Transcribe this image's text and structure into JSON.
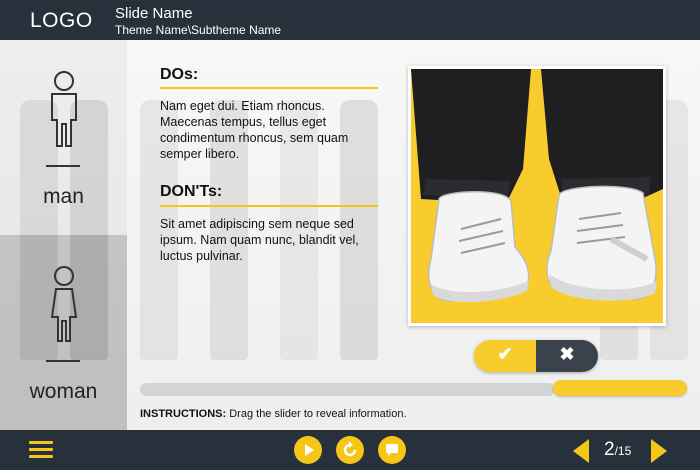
{
  "header": {
    "logo": "LOGO",
    "slide_name": "Slide Name",
    "theme_name": "Theme Name\\Subtheme Name"
  },
  "sidebar": {
    "items": [
      {
        "label": "man",
        "icon": "man-icon",
        "selected": false
      },
      {
        "label": "woman",
        "icon": "woman-icon",
        "selected": true
      }
    ]
  },
  "main": {
    "dos_title": "DOs:",
    "dos_text": "Nam eget dui. Etiam rhoncus. Maecenas tempus, tellus eget condimentum rhoncus, sem quam semper libero.",
    "donts_title": "DON'Ts:",
    "donts_text": "Sit amet adipiscing sem neque sed ipsum. Nam quam nunc, blandit vel, luctus pulvinar.",
    "photo": "sneakers-photo"
  },
  "answer_buttons": {
    "yes_icon": "✔",
    "no_icon": "✖"
  },
  "slider": {
    "value": 1.0
  },
  "instructions": {
    "label": "INSTRUCTIONS:",
    "text": "Drag the slider to reveal information."
  },
  "footer": {
    "page_current": "2",
    "page_total": "/15"
  },
  "colors": {
    "accent": "#f5c518",
    "bar": "#26313b"
  }
}
